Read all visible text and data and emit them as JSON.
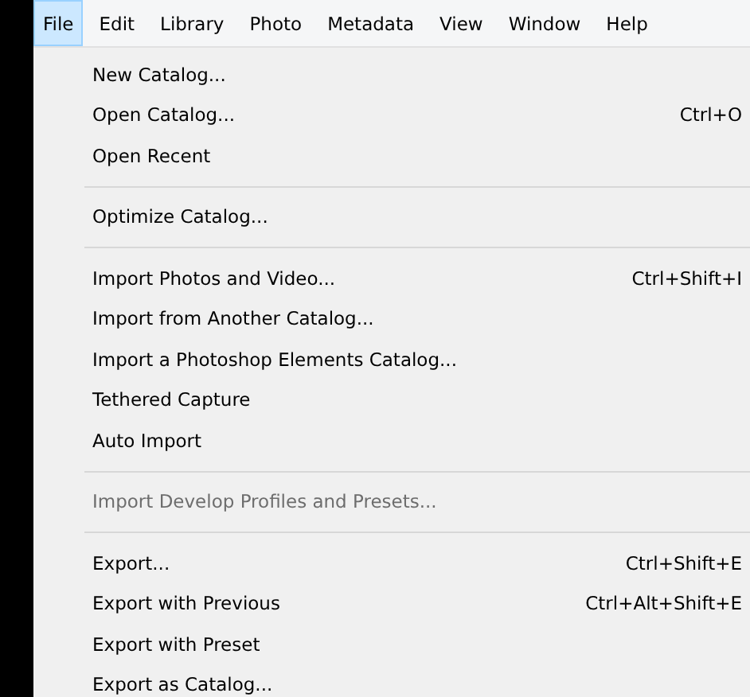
{
  "menu_bar": [
    {
      "label": "File",
      "selected": true
    },
    {
      "label": "Edit",
      "selected": false
    },
    {
      "label": "Library",
      "selected": false
    },
    {
      "label": "Photo",
      "selected": false
    },
    {
      "label": "Metadata",
      "selected": false
    },
    {
      "label": "View",
      "selected": false
    },
    {
      "label": "Window",
      "selected": false
    },
    {
      "label": "Help",
      "selected": false
    }
  ],
  "menu": [
    {
      "kind": "item",
      "label": "New Catalog...",
      "disabled": false
    },
    {
      "kind": "item",
      "label": "Open Catalog...",
      "shortcut": "Ctrl+O",
      "disabled": false
    },
    {
      "kind": "item",
      "label": "Open Recent",
      "disabled": false
    },
    {
      "kind": "separator"
    },
    {
      "kind": "item",
      "label": "Optimize Catalog...",
      "disabled": false
    },
    {
      "kind": "separator"
    },
    {
      "kind": "item",
      "label": "Import Photos and Video...",
      "shortcut": "Ctrl+Shift+I",
      "disabled": false
    },
    {
      "kind": "item",
      "label": "Import from Another Catalog...",
      "disabled": false
    },
    {
      "kind": "item",
      "label": "Import a Photoshop Elements Catalog...",
      "disabled": false
    },
    {
      "kind": "item",
      "label": "Tethered Capture",
      "disabled": false
    },
    {
      "kind": "item",
      "label": "Auto Import",
      "disabled": false
    },
    {
      "kind": "separator"
    },
    {
      "kind": "item",
      "label": "Import Develop Profiles and Presets...",
      "disabled": true
    },
    {
      "kind": "separator"
    },
    {
      "kind": "item",
      "label": "Export...",
      "shortcut": "Ctrl+Shift+E",
      "disabled": false
    },
    {
      "kind": "item",
      "label": "Export with Previous",
      "shortcut": "Ctrl+Alt+Shift+E",
      "disabled": false
    },
    {
      "kind": "item",
      "label": "Export with Preset",
      "disabled": false
    },
    {
      "kind": "item",
      "label": "Export as Catalog...",
      "disabled": false
    }
  ]
}
